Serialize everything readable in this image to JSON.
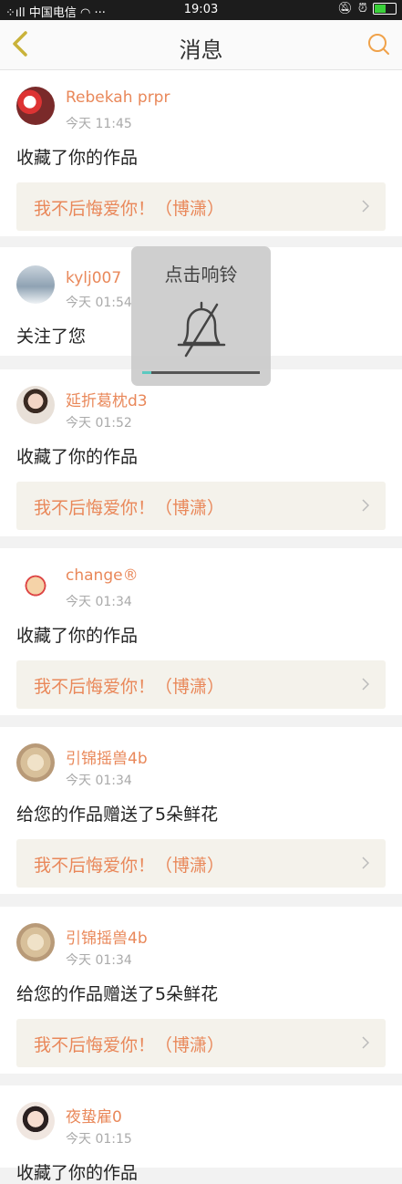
{
  "status_bar": {
    "carrier": "中国电信",
    "time": "19:03"
  },
  "header": {
    "title": "消息",
    "back_icon": "chevron-left-icon",
    "search_icon": "search-icon"
  },
  "messages": [
    {
      "user": "Rebekah prpr",
      "time": "今天 11:45",
      "text": "收藏了你的作品",
      "work": "我不后悔爱你！（博潇）"
    },
    {
      "user": "kylj007",
      "time": "今天 01:54",
      "text": "关注了您"
    },
    {
      "user": "延折葛枕d3",
      "time": "今天 01:52",
      "text": "收藏了你的作品",
      "work": "我不后悔爱你！（博潇）"
    },
    {
      "user": "change®",
      "time": "今天 01:34",
      "text": "收藏了你的作品",
      "work": "我不后悔爱你！（博潇）"
    },
    {
      "user": "引锦摇兽4b",
      "time": "今天 01:34",
      "text": "给您的作品赠送了5朵鲜花",
      "work": "我不后悔爱你！（博潇）"
    },
    {
      "user": "引锦摇兽4b",
      "time": "今天 01:34",
      "text": "给您的作品赠送了5朵鲜花",
      "work": "我不后悔爱你！（博潇）"
    },
    {
      "user": "夜蛰雇0",
      "time": "今天 01:15",
      "text": "收藏了你的作品"
    }
  ],
  "toast": {
    "title": "点击响铃",
    "icon": "bell-muted-icon",
    "volume_level": 0.08
  },
  "colors": {
    "accent": "#e9885a",
    "background": "#f2f2f2",
    "work_background": "#f4f2eb"
  }
}
